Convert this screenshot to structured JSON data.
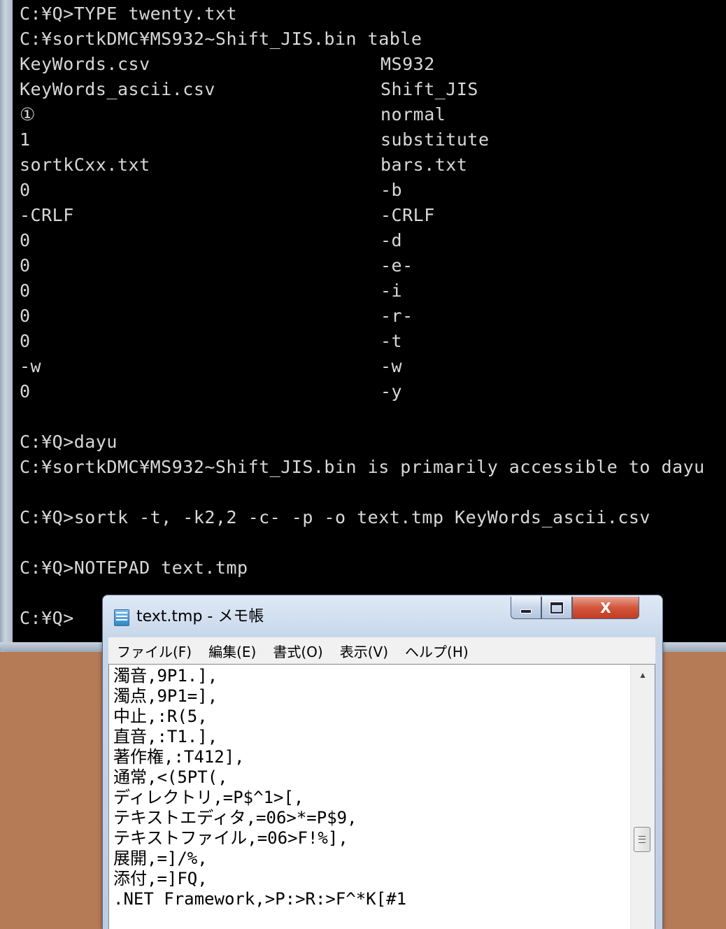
{
  "console": {
    "lines": [
      {
        "a": "C:¥Q>TYPE twenty.txt",
        "b": ""
      },
      {
        "a": "C:¥sortkDMC¥MS932~Shift_JIS.bin table",
        "b": ""
      },
      {
        "a": "KeyWords.csv",
        "b": "MS932"
      },
      {
        "a": "KeyWords_ascii.csv",
        "b": "Shift_JIS"
      },
      {
        "a": "①",
        "b": "normal"
      },
      {
        "a": "1",
        "b": "substitute"
      },
      {
        "a": "sortkCxx.txt",
        "b": "bars.txt"
      },
      {
        "a": "0",
        "b": "-b"
      },
      {
        "a": "-CRLF",
        "b": "-CRLF"
      },
      {
        "a": "0",
        "b": "-d"
      },
      {
        "a": "0",
        "b": "-e-"
      },
      {
        "a": "0",
        "b": "-i"
      },
      {
        "a": "0",
        "b": "-r-"
      },
      {
        "a": "0",
        "b": "-t"
      },
      {
        "a": "-w",
        "b": "-w"
      },
      {
        "a": "0",
        "b": "-y"
      },
      {
        "a": "",
        "b": ""
      },
      {
        "a": "C:¥Q>dayu",
        "b": ""
      },
      {
        "a": "C:¥sortkDMC¥MS932~Shift_JIS.bin is primarily accessible to dayu",
        "b": ""
      },
      {
        "a": "",
        "b": ""
      },
      {
        "a": "C:¥Q>sortk -t, -k2,2 -c- -p -o text.tmp KeyWords_ascii.csv",
        "b": ""
      },
      {
        "a": "",
        "b": ""
      },
      {
        "a": "C:¥Q>NOTEPAD text.tmp",
        "b": ""
      },
      {
        "a": "",
        "b": ""
      },
      {
        "a": "C:¥Q>",
        "b": ""
      }
    ]
  },
  "notepad": {
    "title": "text.tmp - メモ帳",
    "close_glyph": "X",
    "menu": [
      "ファイル(F)",
      "編集(E)",
      "書式(O)",
      "表示(V)",
      "ヘルプ(H)"
    ],
    "lines": [
      "濁音,9P1.],",
      "濁点,9P1=],",
      "中止,:R(5,",
      "直音,:T1.],",
      "著作権,:T412],",
      "通常,<(5PT(,",
      "ディレクトリ,=P$^1>[,",
      "テキストエディタ,=06>*=P$9,",
      "テキストファイル,=06>F!%],",
      "展開,=]/%,",
      "添付,=]FQ,",
      ".NET Framework,>P:>R:>F^*K[#1"
    ],
    "scroll_up_glyph": "▲"
  }
}
